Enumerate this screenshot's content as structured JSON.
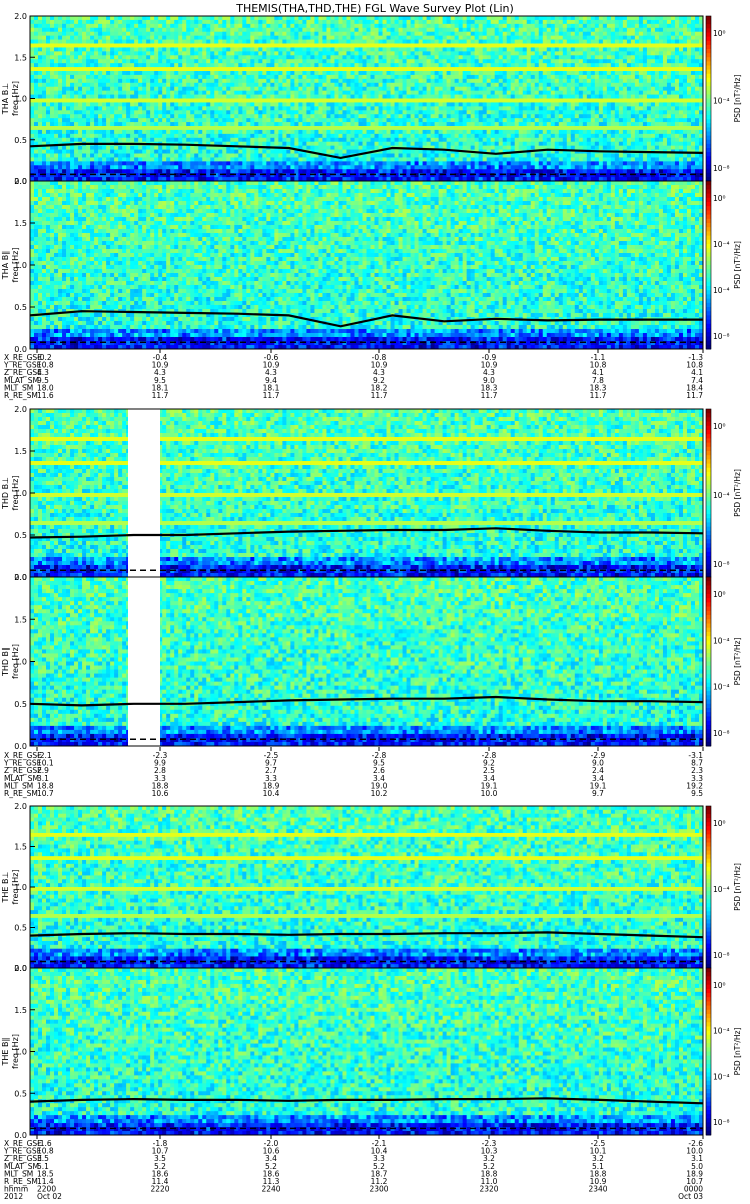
{
  "title": "THEMIS(THA,THD,THE) FGL Wave Survey Plot (Lin)",
  "colorbar_label": "PSD [nT²/Hz]",
  "colorbar_ticks": [
    "10⁰",
    "10⁻⁴",
    "10⁻⁸"
  ],
  "colorbar_ticks_b": [
    "10⁰",
    "10⁻⁴",
    "10⁻⁴",
    "10⁻⁸"
  ],
  "chart_data": [
    {
      "type": "heatmap",
      "panel": "THA B⊥",
      "ylabel": "THA B⊥\nfreq [Hz]",
      "ylim": [
        0,
        2.0
      ],
      "yticks": [
        "2.0",
        "1.5",
        "1.0",
        "0.5",
        "0.0"
      ],
      "xlim": [
        "2012-10-02 22:00",
        "2012-10-03 00:00"
      ],
      "line_freq_hz": [
        0.42,
        0.45,
        0.45,
        0.44,
        0.42,
        0.4,
        0.28,
        0.4,
        0.38,
        0.33,
        0.38,
        0.36,
        0.35,
        0.34
      ],
      "colorscale": "rainbow PSD (log)"
    },
    {
      "type": "heatmap",
      "panel": "THA B∥",
      "ylabel": "THA B∥\nfreq [Hz]",
      "ylim": [
        0,
        2.0
      ],
      "yticks": [
        "2.0",
        "1.5",
        "1.0",
        "0.5",
        "0.0"
      ],
      "line_freq_hz": [
        0.4,
        0.45,
        0.44,
        0.43,
        0.42,
        0.4,
        0.27,
        0.4,
        0.33,
        0.36,
        0.34,
        0.35,
        0.35,
        0.35
      ],
      "colorscale": "rainbow PSD (log)"
    },
    {
      "type": "heatmap",
      "panel": "THD B⊥",
      "ylabel": "THD B⊥\nfreq [Hz]",
      "ylim": [
        0,
        2.0
      ],
      "yticks": [
        "2.0",
        "1.5",
        "1.0",
        "0.5",
        "0.0"
      ],
      "data_gap": [
        "22:17",
        "22:20"
      ],
      "line_freq_hz": [
        0.47,
        0.48,
        0.5,
        0.5,
        0.52,
        0.54,
        0.55,
        0.56,
        0.56,
        0.58,
        0.55,
        0.53,
        0.53,
        0.52
      ],
      "colorscale": "rainbow PSD (log)"
    },
    {
      "type": "heatmap",
      "panel": "THD B∥",
      "ylabel": "THD B∥\nfreq [Hz]",
      "ylim": [
        0,
        2.0
      ],
      "yticks": [
        "2.0",
        "1.5",
        "1.0",
        "0.5",
        "0.0"
      ],
      "data_gap": [
        "22:17",
        "22:20"
      ],
      "line_freq_hz": [
        0.5,
        0.48,
        0.5,
        0.5,
        0.52,
        0.54,
        0.55,
        0.56,
        0.56,
        0.58,
        0.55,
        0.53,
        0.53,
        0.52
      ],
      "colorscale": "rainbow PSD (log)"
    },
    {
      "type": "heatmap",
      "panel": "THE B⊥",
      "ylabel": "THE B⊥\nfreq [Hz]",
      "ylim": [
        0,
        2.0
      ],
      "yticks": [
        "2.0",
        "1.5",
        "1.0",
        "0.5",
        "0.0"
      ],
      "line_freq_hz": [
        0.4,
        0.42,
        0.43,
        0.42,
        0.42,
        0.41,
        0.42,
        0.42,
        0.43,
        0.43,
        0.44,
        0.42,
        0.4,
        0.38
      ],
      "colorscale": "rainbow PSD (log)"
    },
    {
      "type": "heatmap",
      "panel": "THE B∥",
      "ylabel": "THE B∥\nfreq [Hz]",
      "ylim": [
        0,
        2.0
      ],
      "yticks": [
        "2.0",
        "1.5",
        "1.0",
        "0.5",
        "0.0"
      ],
      "line_freq_hz": [
        0.4,
        0.42,
        0.43,
        0.42,
        0.42,
        0.41,
        0.42,
        0.42,
        0.43,
        0.43,
        0.44,
        0.42,
        0.4,
        0.38
      ],
      "colorscale": "rainbow PSD (log)"
    }
  ],
  "ephemeris": [
    {
      "labels": [
        "X_RE_GSE",
        "Y_RE_GSE",
        "Z_RE_GSE",
        "MLAT_SM",
        "MLT_SM",
        "R_RE_SM"
      ],
      "columns": [
        [
          "-0.2",
          "10.8",
          "4.3",
          "9.5",
          "18.0",
          "11.6"
        ],
        [
          "-0.4",
          "10.9",
          "4.3",
          "9.5",
          "18.1",
          "11.7"
        ],
        [
          "-0.6",
          "10.9",
          "4.3",
          "9.4",
          "18.1",
          "11.7"
        ],
        [
          "-0.8",
          "10.9",
          "4.3",
          "9.2",
          "18.2",
          "11.7"
        ],
        [
          "-0.9",
          "10.9",
          "4.3",
          "9.0",
          "18.3",
          "11.7"
        ],
        [
          "-1.1",
          "10.8",
          "4.1",
          "7.8",
          "18.3",
          "11.7"
        ],
        [
          "-1.3",
          "10.8",
          "4.1",
          "7.4",
          "18.4",
          "11.7"
        ]
      ]
    },
    {
      "labels": [
        "X_RE_GSE",
        "Y_RE_GSE",
        "Z_RE_GSE",
        "MLAT_SM",
        "MLT_SM",
        "R_RE_SM"
      ],
      "columns": [
        [
          "-2.1",
          "10.1",
          "2.9",
          "3.1",
          "18.8",
          "10.7"
        ],
        [
          "-2.3",
          "9.9",
          "2.8",
          "3.3",
          "18.8",
          "10.6"
        ],
        [
          "-2.5",
          "9.7",
          "2.7",
          "3.3",
          "18.9",
          "10.4"
        ],
        [
          "-2.8",
          "9.5",
          "2.6",
          "3.4",
          "19.0",
          "10.2"
        ],
        [
          "-2.8",
          "9.2",
          "2.5",
          "3.4",
          "19.1",
          "10.0"
        ],
        [
          "-2.9",
          "9.0",
          "2.4",
          "3.4",
          "19.1",
          "9.7"
        ],
        [
          "-3.1",
          "8.7",
          "2.3",
          "3.3",
          "19.2",
          "9.5"
        ]
      ]
    },
    {
      "labels": [
        "X_RE_GSE",
        "Y_RE_GSE",
        "Z_RE_GSE",
        "MLAT_SM",
        "MLT_SM",
        "R_RE_SM",
        "hhmm",
        "2012"
      ],
      "columns": [
        [
          "-1.6",
          "10.8",
          "3.5",
          "5.1",
          "18.5",
          "11.4",
          "2200",
          "Oct 02"
        ],
        [
          "-1.8",
          "10.7",
          "3.5",
          "5.2",
          "18.6",
          "11.4",
          "2220",
          ""
        ],
        [
          "-2.0",
          "10.6",
          "3.4",
          "5.2",
          "18.6",
          "11.3",
          "2240",
          ""
        ],
        [
          "-2.1",
          "10.4",
          "3.3",
          "5.2",
          "18.7",
          "11.2",
          "2300",
          ""
        ],
        [
          "-2.3",
          "10.3",
          "3.2",
          "5.2",
          "18.8",
          "11.0",
          "2320",
          ""
        ],
        [
          "-2.5",
          "10.1",
          "3.2",
          "5.1",
          "18.8",
          "10.9",
          "2340",
          ""
        ],
        [
          "-2.6",
          "10.0",
          "3.1",
          "5.0",
          "18.9",
          "10.7",
          "0000",
          "Oct 03"
        ]
      ]
    }
  ]
}
